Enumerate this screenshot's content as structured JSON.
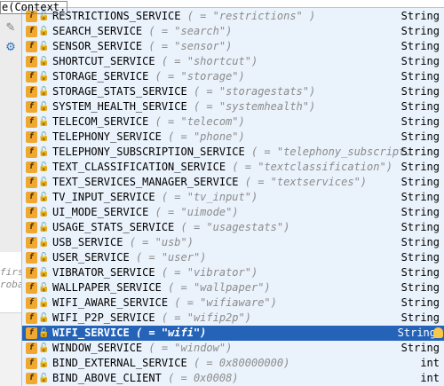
{
  "editor": {
    "code_line": "e(Context.",
    "hint_line_1": "firs",
    "hint_line_2": "robab"
  },
  "colors": {
    "selection": "#2463b8",
    "popup_bg": "#eaf2fb",
    "field_icon": "#f0a830",
    "lock_icon": "#3f9a3f",
    "value_text": "#8c8c8c"
  },
  "icons": {
    "field": "field-icon",
    "lock": "lock-icon",
    "pin": "pin-icon",
    "gear": "gear-icon",
    "bulb": "lightbulb-icon"
  },
  "completion": {
    "items": [
      {
        "name": "RESTRICTIONS_SERVICE",
        "value": "( = \"restrictions\" )",
        "type": "String"
      },
      {
        "name": "SEARCH_SERVICE",
        "value": "( = \"search\")",
        "type": "String"
      },
      {
        "name": "SENSOR_SERVICE",
        "value": "( = \"sensor\")",
        "type": "String"
      },
      {
        "name": "SHORTCUT_SERVICE",
        "value": "( = \"shortcut\")",
        "type": "String"
      },
      {
        "name": "STORAGE_SERVICE",
        "value": "( = \"storage\")",
        "type": "String"
      },
      {
        "name": "STORAGE_STATS_SERVICE",
        "value": "( = \"storagestats\")",
        "type": "String"
      },
      {
        "name": "SYSTEM_HEALTH_SERVICE",
        "value": "( = \"systemhealth\")",
        "type": "String"
      },
      {
        "name": "TELECOM_SERVICE",
        "value": "( = \"telecom\")",
        "type": "String"
      },
      {
        "name": "TELEPHONY_SERVICE",
        "value": "( = \"phone\")",
        "type": "String"
      },
      {
        "name": "TELEPHONY_SUBSCRIPTION_SERVICE",
        "value": "( = \"telephony_subscript…",
        "type": "String"
      },
      {
        "name": "TEXT_CLASSIFICATION_SERVICE",
        "value": "( = \"textclassification\")",
        "type": "String"
      },
      {
        "name": "TEXT_SERVICES_MANAGER_SERVICE",
        "value": "( = \"textservices\")",
        "type": "String"
      },
      {
        "name": "TV_INPUT_SERVICE",
        "value": "( = \"tv_input\")",
        "type": "String"
      },
      {
        "name": "UI_MODE_SERVICE",
        "value": "( = \"uimode\")",
        "type": "String"
      },
      {
        "name": "USAGE_STATS_SERVICE",
        "value": "( = \"usagestats\")",
        "type": "String"
      },
      {
        "name": "USB_SERVICE",
        "value": "( = \"usb\")",
        "type": "String"
      },
      {
        "name": "USER_SERVICE",
        "value": "( = \"user\")",
        "type": "String"
      },
      {
        "name": "VIBRATOR_SERVICE",
        "value": "( = \"vibrator\")",
        "type": "String"
      },
      {
        "name": "WALLPAPER_SERVICE",
        "value": "( = \"wallpaper\")",
        "type": "String"
      },
      {
        "name": "WIFI_AWARE_SERVICE",
        "value": "( = \"wifiaware\")",
        "type": "String"
      },
      {
        "name": "WIFI_P2P_SERVICE",
        "value": "( = \"wifip2p\")",
        "type": "String"
      },
      {
        "name": "WIFI_SERVICE",
        "value": "( = \"wifi\")",
        "type": "String",
        "selected": true
      },
      {
        "name": "WINDOW_SERVICE",
        "value": "( = \"window\")",
        "type": "String"
      },
      {
        "name": "BIND_EXTERNAL_SERVICE",
        "value": "( = 0x80000000)",
        "type": "int"
      },
      {
        "name": "BIND_ABOVE_CLIENT",
        "value": "( = 0x0008)",
        "type": "int"
      }
    ]
  }
}
